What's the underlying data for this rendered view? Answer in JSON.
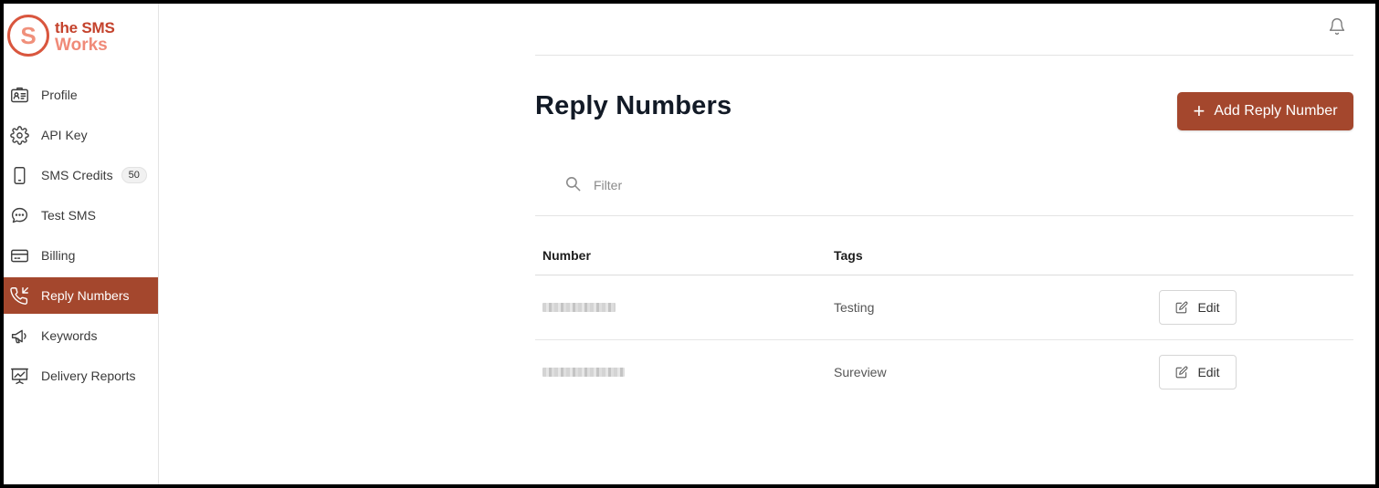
{
  "brand": {
    "letter": "S",
    "line1": "the SMS",
    "line2": "Works"
  },
  "sidebar": {
    "items": [
      {
        "label": "Profile",
        "icon": "id-card-icon"
      },
      {
        "label": "API Key",
        "icon": "gear-icon"
      },
      {
        "label": "SMS Credits",
        "icon": "phone-icon",
        "badge": "50"
      },
      {
        "label": "Test SMS",
        "icon": "chat-bubble-icon"
      },
      {
        "label": "Billing",
        "icon": "credit-card-icon"
      },
      {
        "label": "Reply Numbers",
        "icon": "phone-incoming-icon",
        "active": true
      },
      {
        "label": "Keywords",
        "icon": "megaphone-icon"
      },
      {
        "label": "Delivery Reports",
        "icon": "chart-icon"
      }
    ]
  },
  "header": {
    "icon": "bell-icon"
  },
  "page": {
    "title": "Reply Numbers",
    "add_button": "Add Reply Number",
    "filter_placeholder": "Filter"
  },
  "table": {
    "columns": [
      "Number",
      "Tags"
    ],
    "rows": [
      {
        "number": "",
        "tag": "Testing",
        "action": "Edit"
      },
      {
        "number": "",
        "tag": "Sureview",
        "action": "Edit"
      }
    ]
  },
  "colors": {
    "accent": "#a4472d",
    "logo_dark": "#c4422c",
    "logo_light": "#f08a78"
  }
}
